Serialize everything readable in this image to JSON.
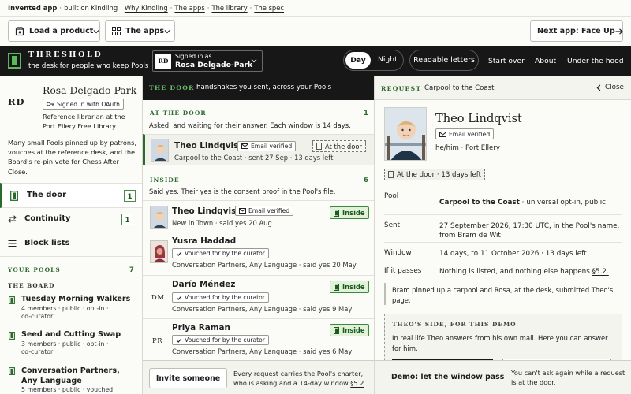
{
  "topstrip": {
    "app_label": "Invented app",
    "built_on": "built on Kindling",
    "links": [
      "Why Kindling",
      "The apps",
      "The library",
      "The spec"
    ]
  },
  "toolbar": {
    "load_product": "Load a product",
    "the_apps": "The apps",
    "next_app": "Next app: Face Up"
  },
  "header": {
    "brand": "THRESHOLD",
    "tagline": "the desk for people who keep Pools",
    "user_initials": "RD",
    "signed_in_label": "Signed in as",
    "user_name": "Rosa Delgado-Park",
    "mode_day": "Day",
    "mode_night": "Night",
    "readable_letters": "Readable letters",
    "links": [
      "Start over",
      "About",
      "Under the hood"
    ]
  },
  "profile": {
    "initials": "RD",
    "name": "Rosa Delgado-Park",
    "oauth_badge": "Signed in with OAuth",
    "role": "Reference librarian at the Port Ellery Free Library",
    "description": "Many small Pools pinned up by patrons, vouches at the reference desk, and the Board's re-pin vote for Chess After Close."
  },
  "nav": [
    {
      "label": "The door",
      "count": "1"
    },
    {
      "label": "Continuity",
      "count": "1"
    },
    {
      "label": "Block lists",
      "count": ""
    }
  ],
  "your_pools": {
    "heading": "YOUR POOLS",
    "count": "7",
    "group": "THE BOARD",
    "pools": [
      {
        "name": "Tuesday Morning Walkers",
        "meta": "4 members · public · opt-in · co-curator"
      },
      {
        "name": "Seed and Cutting Swap",
        "meta": "3 members · public · opt-in · co-curator"
      },
      {
        "name": "Conversation Partners, Any Language",
        "meta": "5 members · public · vouched"
      }
    ]
  },
  "door": {
    "title": "THE DOOR",
    "subtitle": "handshakes you sent, across your Pools",
    "at_door_heading": "AT THE DOOR",
    "at_door_count": "1",
    "at_door_desc": "Asked, and waiting for their answer. Each window is 14 days.",
    "at_door_rows": [
      {
        "name": "Theo Lindqvist",
        "badge": "Email verified",
        "status": "At the door",
        "sub": "Carpool to the Coast · sent 27 Sep · 13 days left"
      }
    ],
    "inside_heading": "INSIDE",
    "inside_count": "6",
    "inside_desc": "Said yes. Their yes is the consent proof in the Pool's file.",
    "inside_rows": [
      {
        "name": "Theo Lindqvist",
        "badge": "Email verified",
        "status": "Inside",
        "sub": "New in Town · said yes 20 Aug",
        "initials": ""
      },
      {
        "name": "Yusra Haddad",
        "badge": "Vouched for by the curator",
        "status": "",
        "sub": "Conversation Partners, Any Language · said yes 20 May",
        "initials": ""
      },
      {
        "name": "Darío Méndez",
        "badge": "Vouched for by the curator",
        "status": "Inside",
        "sub": "Conversation Partners, Any Language · said yes 9 May",
        "initials": "DM"
      },
      {
        "name": "Priya Raman",
        "badge": "Vouched for by the curator",
        "status": "Inside",
        "sub": "Conversation Partners, Any Language · said yes 6 May",
        "initials": "PR"
      }
    ],
    "invite_button": "Invite someone",
    "footer_text": "Every request carries the Pool's charter, who is asking and a 14-day window",
    "footer_link": "§5.2"
  },
  "request": {
    "label": "REQUEST",
    "title": "Carpool to the Coast",
    "close": "Close",
    "name": "Theo Lindqvist",
    "badge": "Email verified",
    "meta": "he/him · Port Ellery",
    "status": "At the door · 13 days left",
    "fields": [
      {
        "key": "Pool",
        "value_link": "Carpool to the Coast",
        "value": " · universal opt-in, public"
      },
      {
        "key": "Sent",
        "value_link": "",
        "value": "27 September 2026, 17:30 UTC, in the Pool's name, from Bram de Wit"
      },
      {
        "key": "Window",
        "value_link": "",
        "value": "14 days, to 11 October 2026 · 13 days left"
      },
      {
        "key": "If it passes",
        "value_link": "",
        "value": "Nothing is listed, and nothing else happens"
      }
    ],
    "if_passes_link": "§5.2.",
    "note": "Bram pinned up a carpool and Rosa, at the desk, submitted Theo's page.",
    "demo_heading": "THEO'S SIDE, FOR THIS DEMO",
    "demo_text": "In real life Theo answers from his own mail. Here you can answer for him.",
    "demo_link": "Demo: let the window pass",
    "demo_note": "You can't ask again while a request is at the door."
  }
}
